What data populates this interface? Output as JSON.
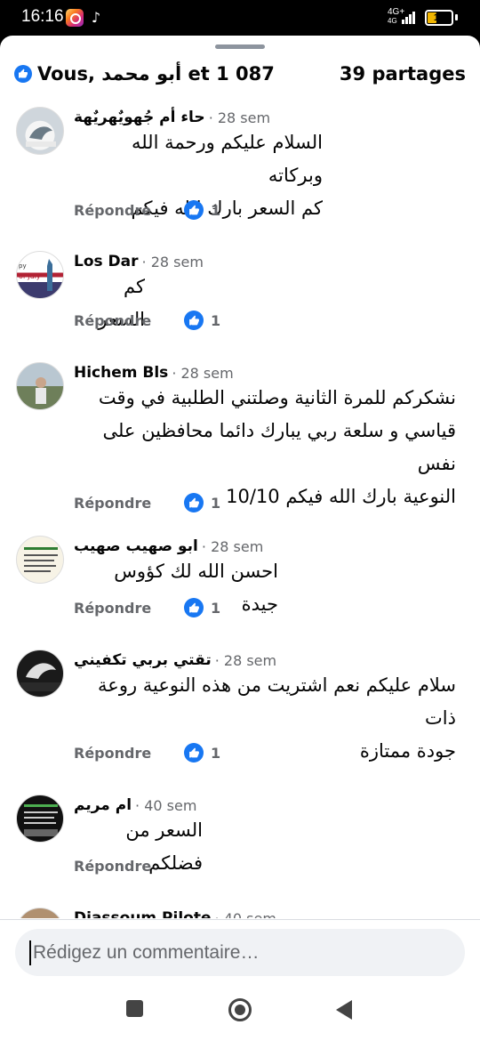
{
  "status_bar": {
    "time": "16:16",
    "network": "4G+",
    "network_sub": "4G",
    "battery": "19"
  },
  "summary": {
    "reactions_label": "Vous, أبو محمد et 1 087",
    "shares_label": "39 partages"
  },
  "comments": [
    {
      "name": "حاء أم جُهويٌهريٌهة",
      "time": "· 28 sem",
      "text": "السلام عليكم ورحمة الله وبركاته\nكم السعر بارك الله فيكم",
      "reply": "Répondre",
      "likes": "1"
    },
    {
      "name": "Los Dar",
      "time": "· 28 sem",
      "text": "كم السعر",
      "reply": "Répondre",
      "likes": "1"
    },
    {
      "name": "Hichem Bls",
      "time": "· 28 sem",
      "text": "نشكركم للمرة الثانية وصلتني الطلبية في وقت\nقياسي و سلعة ربي يبارك دائما محافظين على نفس\nالنوعية بارك الله فيكم 10/10",
      "reply": "Répondre",
      "likes": "1"
    },
    {
      "name": "ابو صهيب صهيب",
      "time": "· 28 sem",
      "text": "احسن الله لك كؤوس جيدة",
      "reply": "Répondre",
      "likes": "1"
    },
    {
      "name": "تقتي بربي تكفيني",
      "time": "· 28 sem",
      "text": "سلام عليكم نعم اشتريت من هذه النوعية روعة ذات\nجودة ممتازة",
      "reply": "Répondre",
      "likes": "1"
    },
    {
      "name": "ام مريم",
      "time": "· 40 sem",
      "text": "السعر من فضلكم",
      "reply": "Répondre",
      "likes": ""
    },
    {
      "name": "Diassoum Pilote",
      "time": "· 40 sem",
      "text": "",
      "reply": "",
      "likes": ""
    }
  ],
  "composer": {
    "placeholder": "Rédigez un commentaire…"
  },
  "colors": {
    "brand_blue": "#1877f2",
    "muted_text": "#65676b",
    "composer_bg": "#f0f2f5"
  },
  "icons": {
    "like": "thumbs-up-icon",
    "nav_recents": "square-icon",
    "nav_home": "circle-icon",
    "nav_back": "triangle-back-icon"
  }
}
